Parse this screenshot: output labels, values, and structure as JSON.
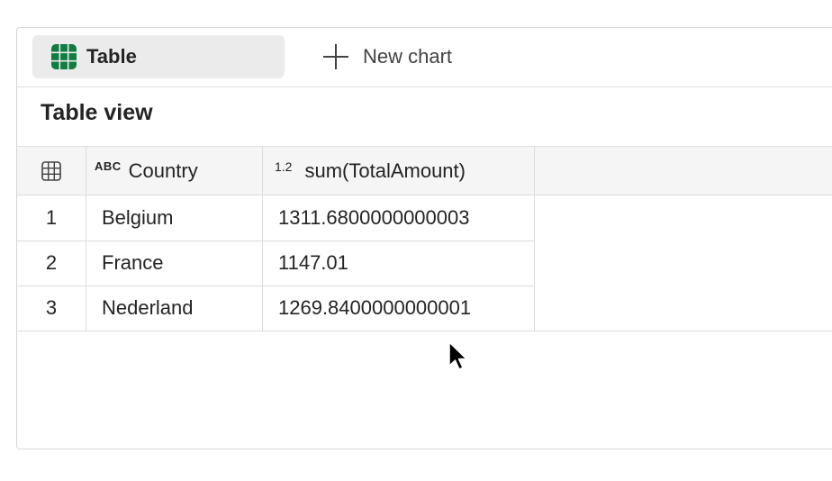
{
  "tabs": {
    "table_label": "Table",
    "new_chart_label": "New chart"
  },
  "view": {
    "title": "Table view"
  },
  "table": {
    "columns": [
      {
        "type_badge": "ABC",
        "label": "Country"
      },
      {
        "type_badge": "1.2",
        "label": "sum(TotalAmount)"
      }
    ],
    "rows": [
      {
        "index": "1",
        "country": "Belgium",
        "amount": "1311.6800000000003"
      },
      {
        "index": "2",
        "country": "France",
        "amount": "1147.01"
      },
      {
        "index": "3",
        "country": "Nederland",
        "amount": "1269.8400000000001"
      }
    ]
  },
  "icons": {
    "table_tab": "table-grid-icon",
    "new_chart": "plus-icon",
    "row_header": "grid-icon",
    "pointer": "mouse-cursor-icon"
  },
  "colors": {
    "table_icon": "#107c41",
    "tab_selected_bg": "#ebebeb",
    "header_bg": "#f5f5f5",
    "border": "#dcdcdc"
  }
}
